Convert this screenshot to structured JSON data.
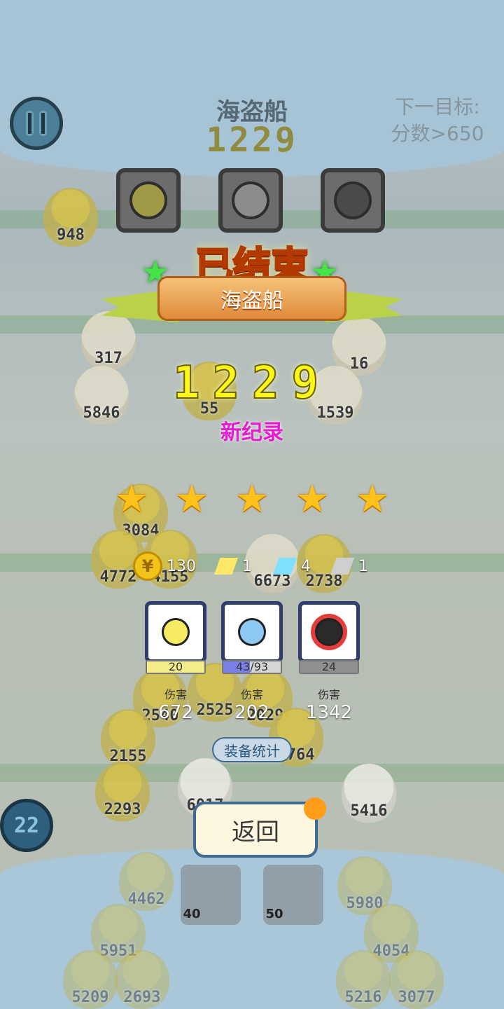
{
  "hud": {
    "level_name": "海盗船",
    "current_score": "1229",
    "next_target_line1": "下一目标:",
    "next_target_line2": "分数>650",
    "water_drops": "22"
  },
  "board": {
    "chicks": [
      {
        "hp": "948"
      },
      {
        "hp": "317"
      },
      {
        "hp": "16"
      },
      {
        "hp": "5846"
      },
      {
        "hp": "55"
      },
      {
        "hp": "1539"
      },
      {
        "hp": "3084"
      },
      {
        "hp": "4772"
      },
      {
        "hp": "4155"
      },
      {
        "hp": "6673"
      },
      {
        "hp": "2738"
      },
      {
        "hp": "2540"
      },
      {
        "hp": "2525"
      },
      {
        "hp": "2029"
      },
      {
        "hp": "2155"
      },
      {
        "hp": "2764"
      },
      {
        "hp": "2293"
      },
      {
        "hp": "6017"
      },
      {
        "hp": "5416"
      },
      {
        "hp": "4462"
      },
      {
        "hp": "5980"
      },
      {
        "hp": "5951"
      },
      {
        "hp": "4054"
      },
      {
        "hp": "5209"
      },
      {
        "hp": "2693"
      },
      {
        "hp": "5216"
      },
      {
        "hp": "3077"
      }
    ],
    "skills": [
      {
        "cost": "40",
        "icon": "sad-face-icon"
      },
      {
        "cost": "50",
        "icon": "headphone-face-icon"
      }
    ]
  },
  "result": {
    "status_title": "已结束",
    "level_name": "海盗船",
    "final_score": "1229",
    "new_record_label": "新纪录",
    "stars_earned": 5,
    "stars_total": 5,
    "rewards": {
      "coins": "130",
      "yellow_crystal": "1",
      "blue_crystal": "4",
      "gray_crystal": "1"
    },
    "coin_symbol": "¥",
    "equipment": [
      {
        "icon": "neutral-face-icon",
        "level": "20",
        "damage_label": "伤害",
        "damage": "672",
        "fill": 1.0,
        "fill_color": "#f2ec8a"
      },
      {
        "icon": "frown-face-icon",
        "level_current": "43",
        "level_max": "/93",
        "damage_label": "伤害",
        "damage": "202",
        "fill": 0.46,
        "fill_color": "#7b7fe6"
      },
      {
        "icon": "headphone-face-icon",
        "level": "24",
        "damage_label": "伤害",
        "damage": "1342",
        "fill": 1.0,
        "fill_color": "#8f8f8f"
      }
    ],
    "stats_button_label": "装备统计",
    "back_button_label": "返回"
  },
  "colors": {
    "title_orange": "#ffb21f",
    "score_yellow": "#fff61a",
    "record_magenta": "#e61bd1",
    "star_gold": "#ffc21a",
    "button_border": "#3e6b8f",
    "notify_orange": "#ff9d1a"
  }
}
